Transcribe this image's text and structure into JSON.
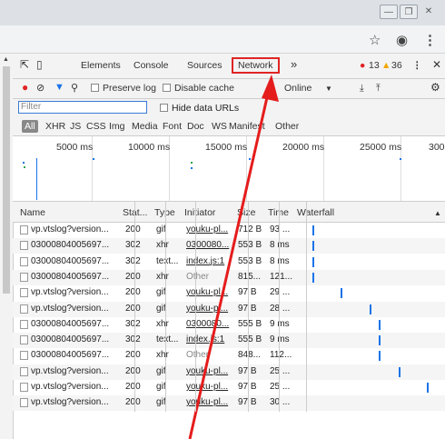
{
  "window": {
    "controls": [
      "minimize-icon",
      "restore-icon",
      "close-icon"
    ]
  },
  "browser": {
    "icons": [
      "star-icon",
      "account-icon",
      "menu-icon"
    ]
  },
  "devtools": {
    "tabs": [
      "Elements",
      "Console",
      "Sources",
      "Network"
    ],
    "active_tab": "Network",
    "errors": "13",
    "warnings": "36",
    "toolbar": {
      "preserve_log": "Preserve log",
      "disable_cache": "Disable cache",
      "throttle": "Online",
      "hide_data_urls": "Hide data URLs"
    },
    "filter_placeholder": "Filter",
    "types": [
      "All",
      "XHR",
      "JS",
      "CSS",
      "Img",
      "Media",
      "Font",
      "Doc",
      "WS",
      "Manifest",
      "Other"
    ],
    "overview_ticks": [
      "5000 ms",
      "10000 ms",
      "15000 ms",
      "20000 ms",
      "25000 ms",
      "300"
    ],
    "columns": {
      "name": "Name",
      "status": "Stat...",
      "type": "Type",
      "initiator": "Initiator",
      "size": "Size",
      "time": "Time",
      "waterfall": "Waterfall"
    },
    "rows": [
      {
        "name": "vp.vtslog?version...",
        "status": "200",
        "type": "gif",
        "initiator": "youku-pl...",
        "size": "712 B",
        "time": "93 ...",
        "wf": 0.0
      },
      {
        "name": "03000804005697...",
        "status": "302",
        "type": "xhr",
        "initiator": "0300080...",
        "size": "553 B",
        "time": "8 ms",
        "wf": 0.0
      },
      {
        "name": "03000804005697...",
        "status": "302",
        "type": "text...",
        "initiator": "index.js:1",
        "size": "553 B",
        "time": "8 ms",
        "wf": 0.0
      },
      {
        "name": "03000804005697...",
        "status": "200",
        "type": "xhr",
        "initiator": "Other",
        "size": "815...",
        "time": "121...",
        "wf": 0.0
      },
      {
        "name": "vp.vtslog?version...",
        "status": "200",
        "type": "gif",
        "initiator": "youku-pl...",
        "size": "97 B",
        "time": "29 ...",
        "wf": 0.22
      },
      {
        "name": "vp.vtslog?version...",
        "status": "200",
        "type": "gif",
        "initiator": "youku-pl...",
        "size": "97 B",
        "time": "28 ...",
        "wf": 0.45
      },
      {
        "name": "03000804005697...",
        "status": "302",
        "type": "xhr",
        "initiator": "0300080...",
        "size": "555 B",
        "time": "9 ms",
        "wf": 0.52
      },
      {
        "name": "03000804005697...",
        "status": "302",
        "type": "text...",
        "initiator": "index.js:1",
        "size": "555 B",
        "time": "9 ms",
        "wf": 0.52
      },
      {
        "name": "03000804005697...",
        "status": "200",
        "type": "xhr",
        "initiator": "Other",
        "size": "848...",
        "time": "112...",
        "wf": 0.52
      },
      {
        "name": "vp.vtslog?version...",
        "status": "200",
        "type": "gif",
        "initiator": "youku-pl...",
        "size": "97 B",
        "time": "25 ...",
        "wf": 0.68
      },
      {
        "name": "vp.vtslog?version...",
        "status": "200",
        "type": "gif",
        "initiator": "youku-pl...",
        "size": "97 B",
        "time": "25 ...",
        "wf": 0.9
      },
      {
        "name": "vp.vtslog?version...",
        "status": "200",
        "type": "gif",
        "initiator": "youku-pl...",
        "size": "97 B",
        "time": "30 ...",
        "wf": null
      }
    ],
    "colors": {
      "error": "#e02424",
      "warning": "#f2a600",
      "accent": "#1a73e8",
      "annotation": "#e51c1c"
    }
  }
}
